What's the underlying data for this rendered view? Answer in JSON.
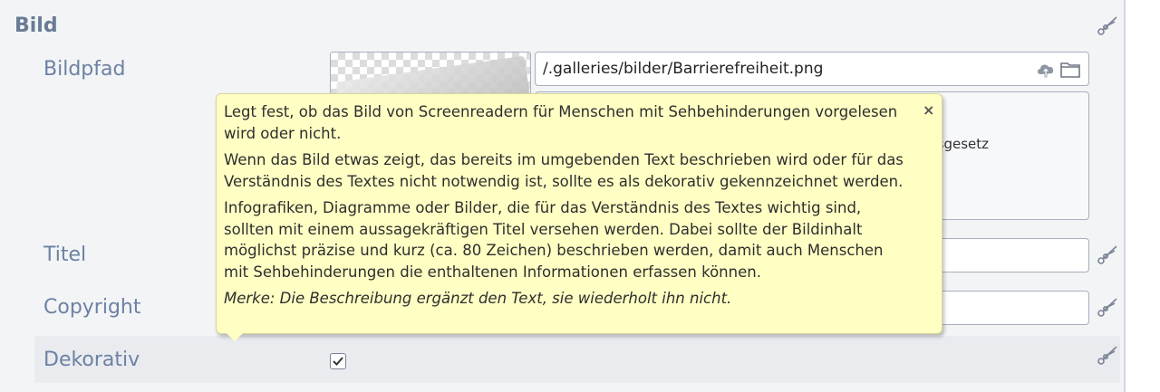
{
  "section": {
    "title": "Bild"
  },
  "fields": {
    "bildpfad": {
      "label": "Bildpfad",
      "value": "/.galleries/bilder/Barrierefreiheit.png"
    },
    "description_fragment": "sgesetz",
    "titel": {
      "label": "Titel",
      "value": ""
    },
    "copyright": {
      "label": "Copyright",
      "value": ""
    },
    "dekorativ": {
      "label": "Dekorativ",
      "checked": true
    }
  },
  "tooltip": {
    "close": "×",
    "p1": "Legt fest, ob das Bild von Screenreadern für Menschen mit Sehbehinderungen vorgelesen wird oder nicht.",
    "p2": "Wenn das Bild etwas zeigt, das bereits im umgebenden Text beschrieben wird oder für das Verständnis des Textes nicht notwendig ist, sollte es als dekorativ gekennzeichnet werden.",
    "p3": "Infografiken, Diagramme oder Bilder, die für das Verständnis des Textes wichtig sind, sollten mit einem aussagekräftigen Titel versehen werden. Dabei sollte der Bildinhalt möglichst präzise und kurz (ca. 80 Zeichen) beschrieben werden, damit auch Menschen mit Sehbehinderungen die enthaltenen Informationen erfassen können.",
    "note": "Merke: Die Beschreibung ergänzt den Text, sie wiederholt ihn nicht."
  },
  "icons": {
    "remove": "scissors-icon",
    "upload": "cloud-upload-icon",
    "browse": "folder-icon",
    "check": "checkmark-icon"
  },
  "colors": {
    "tooltip_bg": "#ffffc4",
    "label": "#6c82a3",
    "panel": "#f3f4f6"
  }
}
